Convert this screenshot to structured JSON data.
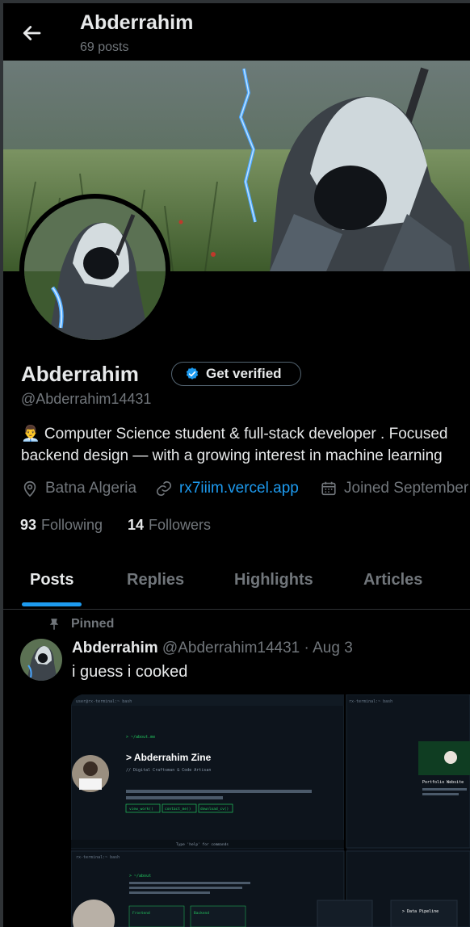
{
  "header": {
    "title": "Abderrahim",
    "posts_count": "69 posts"
  },
  "profile": {
    "name": "Abderrahim",
    "verify_label": "Get verified",
    "handle": "@Abderrahim14431",
    "bio_line1": "👨‍💼 Computer Science student & full-stack developer . Focused",
    "bio_line2": "backend design — with a growing  interest in machine learning",
    "location": "Batna Algeria",
    "website": "rx7iiim.vercel.app",
    "joined": "Joined September",
    "following_count": "93",
    "following_label": "Following",
    "followers_count": "14",
    "followers_label": "Followers"
  },
  "tabs": [
    {
      "label": "Posts"
    },
    {
      "label": "Replies"
    },
    {
      "label": "Highlights"
    },
    {
      "label": "Articles"
    }
  ],
  "pinned_post": {
    "pinned_label": "Pinned",
    "author_name": "Abderrahim",
    "author_handle": "@Abderrahim14431",
    "date": "· Aug 3",
    "text": "i guess i cooked",
    "media": {
      "panel1_title": "user@rx-terminal:~ bash",
      "whoami": "> Abderrahim Zine",
      "subtitle": "// Digital Craftsman & Code Artisan",
      "help_hint": "Type 'help' for commands",
      "panel2_title": "rx-terminal:~ bash",
      "card_title": "Portfolio Website",
      "panel3_title": "rx-terminal:~ bash",
      "about": "> ~/about",
      "card2_title": "> Data Pipeline",
      "btn1": "view_work()",
      "btn2": "contact_me()",
      "btn3": "download_cv()",
      "frontend": "Frontend",
      "backend": "Backend"
    }
  },
  "colors": {
    "accent": "#1d9bf0",
    "muted": "#71767b",
    "text": "#e7e9ea",
    "terminal_green": "#22c55e"
  }
}
